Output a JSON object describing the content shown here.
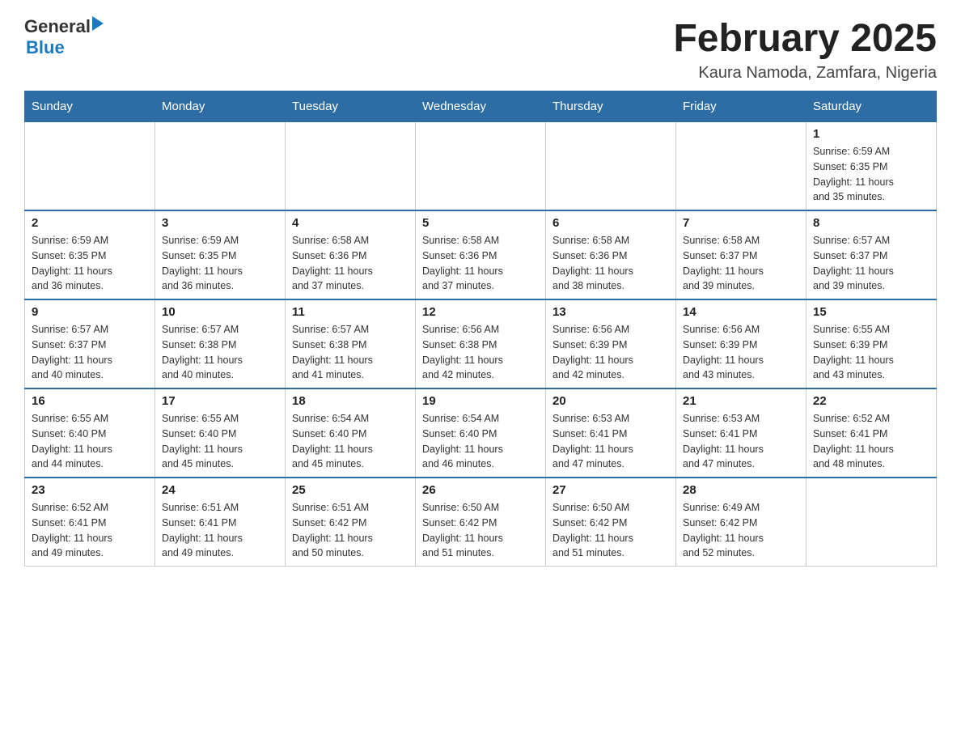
{
  "header": {
    "logo_general": "General",
    "logo_blue": "Blue",
    "month_title": "February 2025",
    "location": "Kaura Namoda, Zamfara, Nigeria"
  },
  "weekdays": [
    "Sunday",
    "Monday",
    "Tuesday",
    "Wednesday",
    "Thursday",
    "Friday",
    "Saturday"
  ],
  "weeks": [
    [
      {
        "day": "",
        "info": ""
      },
      {
        "day": "",
        "info": ""
      },
      {
        "day": "",
        "info": ""
      },
      {
        "day": "",
        "info": ""
      },
      {
        "day": "",
        "info": ""
      },
      {
        "day": "",
        "info": ""
      },
      {
        "day": "1",
        "info": "Sunrise: 6:59 AM\nSunset: 6:35 PM\nDaylight: 11 hours\nand 35 minutes."
      }
    ],
    [
      {
        "day": "2",
        "info": "Sunrise: 6:59 AM\nSunset: 6:35 PM\nDaylight: 11 hours\nand 36 minutes."
      },
      {
        "day": "3",
        "info": "Sunrise: 6:59 AM\nSunset: 6:35 PM\nDaylight: 11 hours\nand 36 minutes."
      },
      {
        "day": "4",
        "info": "Sunrise: 6:58 AM\nSunset: 6:36 PM\nDaylight: 11 hours\nand 37 minutes."
      },
      {
        "day": "5",
        "info": "Sunrise: 6:58 AM\nSunset: 6:36 PM\nDaylight: 11 hours\nand 37 minutes."
      },
      {
        "day": "6",
        "info": "Sunrise: 6:58 AM\nSunset: 6:36 PM\nDaylight: 11 hours\nand 38 minutes."
      },
      {
        "day": "7",
        "info": "Sunrise: 6:58 AM\nSunset: 6:37 PM\nDaylight: 11 hours\nand 39 minutes."
      },
      {
        "day": "8",
        "info": "Sunrise: 6:57 AM\nSunset: 6:37 PM\nDaylight: 11 hours\nand 39 minutes."
      }
    ],
    [
      {
        "day": "9",
        "info": "Sunrise: 6:57 AM\nSunset: 6:37 PM\nDaylight: 11 hours\nand 40 minutes."
      },
      {
        "day": "10",
        "info": "Sunrise: 6:57 AM\nSunset: 6:38 PM\nDaylight: 11 hours\nand 40 minutes."
      },
      {
        "day": "11",
        "info": "Sunrise: 6:57 AM\nSunset: 6:38 PM\nDaylight: 11 hours\nand 41 minutes."
      },
      {
        "day": "12",
        "info": "Sunrise: 6:56 AM\nSunset: 6:38 PM\nDaylight: 11 hours\nand 42 minutes."
      },
      {
        "day": "13",
        "info": "Sunrise: 6:56 AM\nSunset: 6:39 PM\nDaylight: 11 hours\nand 42 minutes."
      },
      {
        "day": "14",
        "info": "Sunrise: 6:56 AM\nSunset: 6:39 PM\nDaylight: 11 hours\nand 43 minutes."
      },
      {
        "day": "15",
        "info": "Sunrise: 6:55 AM\nSunset: 6:39 PM\nDaylight: 11 hours\nand 43 minutes."
      }
    ],
    [
      {
        "day": "16",
        "info": "Sunrise: 6:55 AM\nSunset: 6:40 PM\nDaylight: 11 hours\nand 44 minutes."
      },
      {
        "day": "17",
        "info": "Sunrise: 6:55 AM\nSunset: 6:40 PM\nDaylight: 11 hours\nand 45 minutes."
      },
      {
        "day": "18",
        "info": "Sunrise: 6:54 AM\nSunset: 6:40 PM\nDaylight: 11 hours\nand 45 minutes."
      },
      {
        "day": "19",
        "info": "Sunrise: 6:54 AM\nSunset: 6:40 PM\nDaylight: 11 hours\nand 46 minutes."
      },
      {
        "day": "20",
        "info": "Sunrise: 6:53 AM\nSunset: 6:41 PM\nDaylight: 11 hours\nand 47 minutes."
      },
      {
        "day": "21",
        "info": "Sunrise: 6:53 AM\nSunset: 6:41 PM\nDaylight: 11 hours\nand 47 minutes."
      },
      {
        "day": "22",
        "info": "Sunrise: 6:52 AM\nSunset: 6:41 PM\nDaylight: 11 hours\nand 48 minutes."
      }
    ],
    [
      {
        "day": "23",
        "info": "Sunrise: 6:52 AM\nSunset: 6:41 PM\nDaylight: 11 hours\nand 49 minutes."
      },
      {
        "day": "24",
        "info": "Sunrise: 6:51 AM\nSunset: 6:41 PM\nDaylight: 11 hours\nand 49 minutes."
      },
      {
        "day": "25",
        "info": "Sunrise: 6:51 AM\nSunset: 6:42 PM\nDaylight: 11 hours\nand 50 minutes."
      },
      {
        "day": "26",
        "info": "Sunrise: 6:50 AM\nSunset: 6:42 PM\nDaylight: 11 hours\nand 51 minutes."
      },
      {
        "day": "27",
        "info": "Sunrise: 6:50 AM\nSunset: 6:42 PM\nDaylight: 11 hours\nand 51 minutes."
      },
      {
        "day": "28",
        "info": "Sunrise: 6:49 AM\nSunset: 6:42 PM\nDaylight: 11 hours\nand 52 minutes."
      },
      {
        "day": "",
        "info": ""
      }
    ]
  ]
}
